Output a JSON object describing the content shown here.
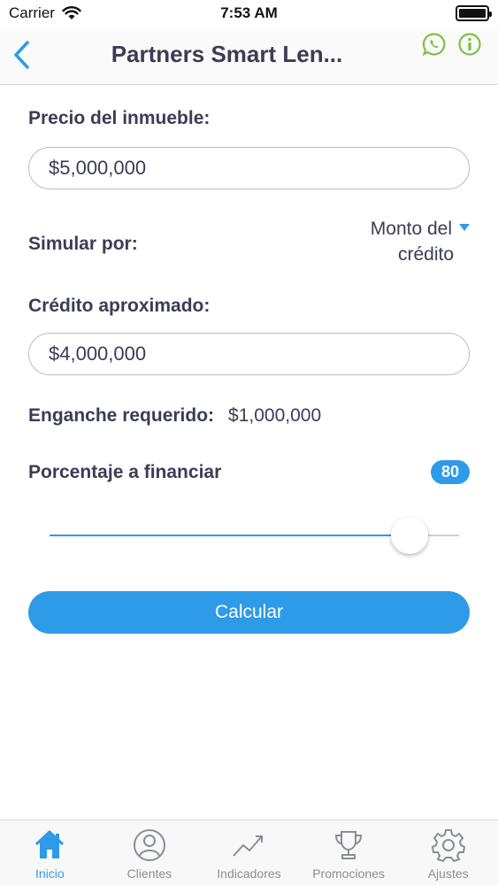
{
  "status": {
    "carrier": "Carrier",
    "time": "7:53 AM"
  },
  "nav": {
    "title": "Partners Smart Len..."
  },
  "form": {
    "precio_label": "Precio del inmueble:",
    "precio_value": "$5,000,000",
    "simular_label": "Simular por:",
    "simular_option_line1": "Monto del",
    "simular_option_line2": "crédito",
    "credito_label": "Crédito aproximado:",
    "credito_value": "$4,000,000",
    "enganche_label": "Enganche requerido:",
    "enganche_value": "$1,000,000",
    "porcentaje_label": "Porcentaje a financiar",
    "porcentaje_value": "80",
    "slider_fraction": 0.88,
    "calcular_label": "Calcular"
  },
  "tabs": [
    {
      "label": "Inicio",
      "icon": "home-icon",
      "active": true
    },
    {
      "label": "Clientes",
      "icon": "user-icon",
      "active": false
    },
    {
      "label": "Indicadores",
      "icon": "trend-icon",
      "active": false
    },
    {
      "label": "Promociones",
      "icon": "trophy-icon",
      "active": false
    },
    {
      "label": "Ajustes",
      "icon": "gear-icon",
      "active": false
    }
  ],
  "colors": {
    "accent": "#2e9be8",
    "whatsapp": "#7cc242",
    "text": "#3a3d55"
  }
}
